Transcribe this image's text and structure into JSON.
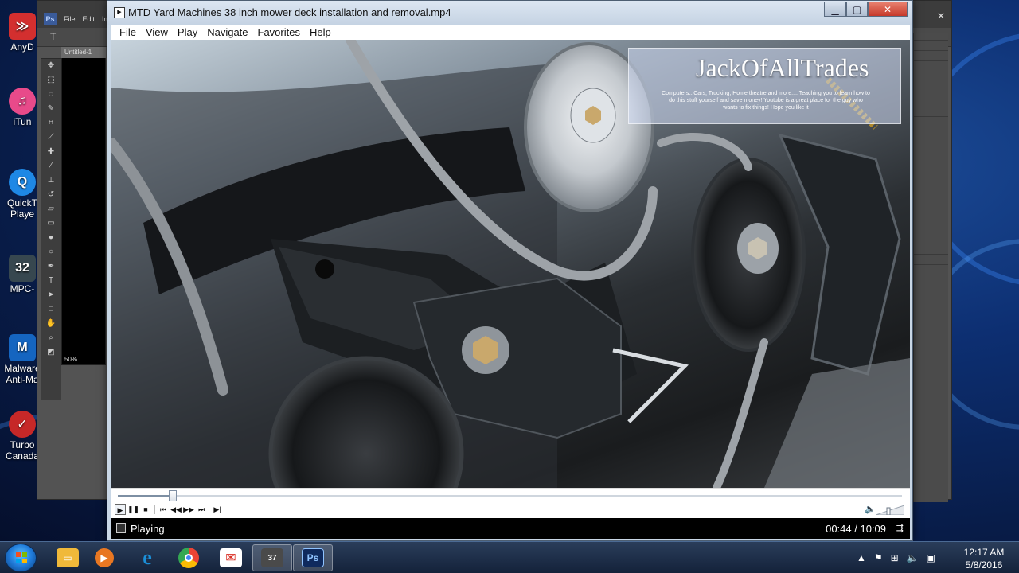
{
  "desktop": {
    "icons": [
      {
        "label": "AnyD",
        "icon": "anydesk-icon",
        "color": "#d32f2f",
        "glyph": "≫"
      },
      {
        "label": "iTun",
        "icon": "itunes-icon",
        "color": "#e84a8a",
        "glyph": "♫"
      },
      {
        "label": "QuickT Playe",
        "icon": "quicktime-icon",
        "color": "#1e88e5",
        "glyph": "Q"
      },
      {
        "label": "MPC-",
        "icon": "mpc-icon",
        "color": "#37474f",
        "glyph": "32"
      },
      {
        "label": "Malware Anti-Ma",
        "icon": "malwarebytes-icon",
        "color": "#1565c0",
        "glyph": "M"
      },
      {
        "label": "Turbo Canada",
        "icon": "turbotax-icon",
        "color": "#c62828",
        "glyph": "✓"
      }
    ]
  },
  "photoshop": {
    "logo": "Ps",
    "menu": [
      "File",
      "Edit",
      "Im"
    ],
    "doc_tab": "Untitled-1",
    "zoom": "50%"
  },
  "player": {
    "title": "MTD Yard Machines 38 inch mower deck installation and removal.mp4",
    "menu": [
      "File",
      "View",
      "Play",
      "Navigate",
      "Favorites",
      "Help"
    ],
    "overlay": {
      "title": "JackOfAllTrades",
      "description": "Computers...Cars, Trucking, Home theatre and more.... Teaching you to learn how to do this stuff yourself and save money! Youtube is a great place for the guy who wants to fix things! Hope you like it"
    },
    "seek_progress": 0.07,
    "status": "Playing",
    "time": "00:44 / 10:09"
  },
  "taskbar": {
    "apps": [
      {
        "name": "explorer",
        "icon": "folder-icon",
        "color": "#f0b93a"
      },
      {
        "name": "media-player",
        "icon": "media-player-icon",
        "color": "#e87722"
      },
      {
        "name": "internet-explorer",
        "icon": "internet-explorer-icon",
        "color": "#1b8fd8"
      },
      {
        "name": "chrome",
        "icon": "chrome-icon",
        "color": "#34a853"
      },
      {
        "name": "gmail",
        "icon": "mail-icon",
        "color": "#d93025"
      },
      {
        "name": "mpc",
        "icon": "mpc-icon",
        "color": "#4a4a4a"
      },
      {
        "name": "photoshop",
        "icon": "photoshop-icon",
        "color": "#0f2a5e"
      }
    ],
    "clock_time": "12:17 AM",
    "clock_date": "5/8/2016"
  }
}
